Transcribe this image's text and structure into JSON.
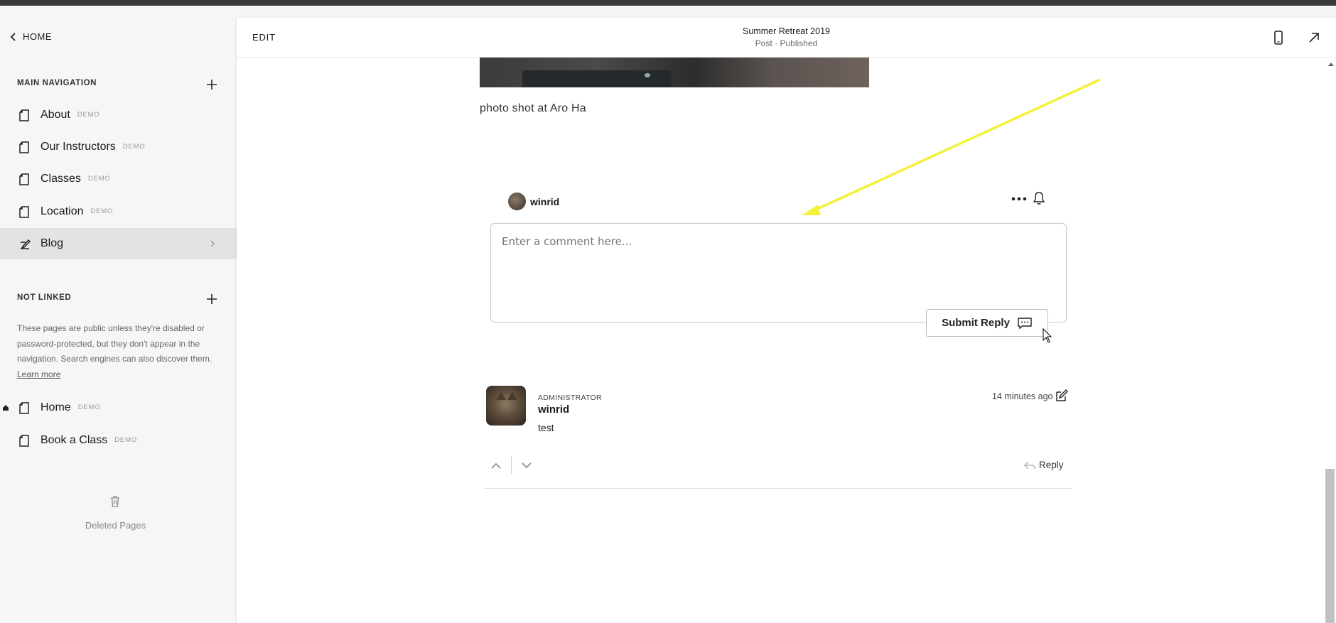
{
  "sidebar": {
    "home_label": "HOME",
    "main_nav_title": "MAIN NAVIGATION",
    "main_nav_items": [
      {
        "label": "About",
        "badge": "DEMO"
      },
      {
        "label": "Our Instructors",
        "badge": "DEMO"
      },
      {
        "label": "Classes",
        "badge": "DEMO"
      },
      {
        "label": "Location",
        "badge": "DEMO"
      },
      {
        "label": "Blog",
        "badge": ""
      }
    ],
    "not_linked_title": "NOT LINKED",
    "not_linked_desc": "These pages are public unless they're disabled or password-protected, but they don't appear in the navigation. Search engines can also discover them.",
    "learn_more": "Learn more",
    "not_linked_items": [
      {
        "label": "Home",
        "badge": "DEMO"
      },
      {
        "label": "Book a Class",
        "badge": "DEMO"
      }
    ],
    "deleted_pages": "Deleted Pages"
  },
  "editbar": {
    "edit_label": "EDIT",
    "title": "Summer Retreat 2019",
    "subtitle": "Post · Published"
  },
  "content": {
    "caption": "photo shot at Aro Ha",
    "commenter_name": "winrid",
    "comment_placeholder": "Enter a comment here...",
    "submit_label": "Submit Reply",
    "comment": {
      "role": "ADMINISTRATOR",
      "author": "winrid",
      "body": "test",
      "time": "14 minutes ago",
      "reply_label": "Reply"
    }
  },
  "colors": {
    "annotation_arrow": "#f2f23a",
    "active_nav_bg": "#e3e3e3"
  }
}
